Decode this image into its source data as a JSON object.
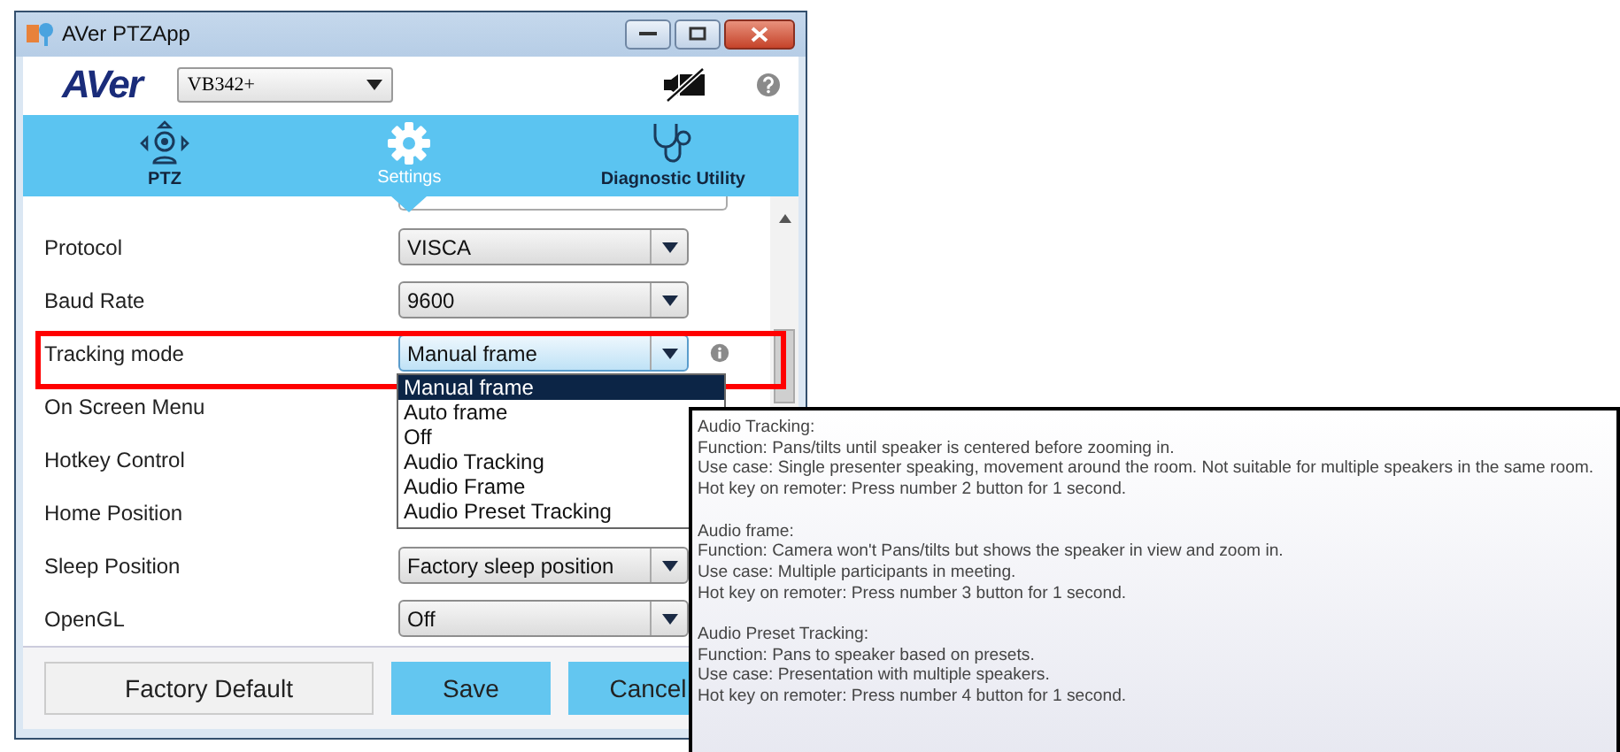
{
  "window": {
    "title": "AVer PTZApp"
  },
  "header": {
    "logo": "AVer",
    "camera_model": "VB342+"
  },
  "tabs": [
    {
      "label": "PTZ",
      "kind": "ptz",
      "selected": false
    },
    {
      "label": "Settings",
      "kind": "gear",
      "selected": true
    },
    {
      "label": "Diagnostic Utility",
      "kind": "stethoscope",
      "selected": false
    }
  ],
  "settings": [
    {
      "label": "Protocol",
      "value": "VISCA",
      "help_icon": false
    },
    {
      "label": "Baud Rate",
      "value": "9600",
      "help_icon": false
    },
    {
      "label": "Tracking mode",
      "value": "Manual frame",
      "help_icon": true
    },
    {
      "label": "On Screen Menu",
      "help_icon": false
    },
    {
      "label": "Hotkey Control",
      "help_icon": false
    },
    {
      "label": "Home Position",
      "help_icon": false
    },
    {
      "label": "Sleep Position",
      "value": "Factory sleep position",
      "help_icon": false
    },
    {
      "label": "OpenGL",
      "value": "Off",
      "help_icon": false
    }
  ],
  "tracking_dropdown": {
    "options": [
      {
        "label": "Manual frame",
        "selected": true
      },
      {
        "label": "Auto frame",
        "selected": false
      },
      {
        "label": "Off",
        "selected": false
      },
      {
        "label": "Audio Tracking",
        "selected": false
      },
      {
        "label": "Audio Frame",
        "selected": false
      },
      {
        "label": "Audio Preset Tracking",
        "selected": false
      }
    ]
  },
  "buttons": [
    {
      "label": "Factory Default",
      "kind": "plain"
    },
    {
      "label": "Save",
      "kind": "primary"
    },
    {
      "label": "Cancel",
      "kind": "primary"
    }
  ],
  "tooltip": [
    [
      "Audio Tracking:",
      "Function: Pans/tilts until speaker is centered before zooming in.",
      "Use case: Single presenter speaking, movement around the room. Not suitable for multiple speakers in the same room.",
      "Hot key on remoter: Press number 2 button for 1 second."
    ],
    [
      "Audio frame:",
      "Function: Camera won't Pans/tilts but shows the speaker in view and zoom in.",
      "Use case: Multiple participants in meeting.",
      "Hot key on remoter: Press number 3 button for 1 second."
    ],
    [
      "Audio Preset Tracking:",
      "Function: Pans to speaker based on presets.",
      "Use case: Presentation with multiple speakers.",
      "Hot key on remoter: Press number 4 button for 1 second."
    ]
  ]
}
